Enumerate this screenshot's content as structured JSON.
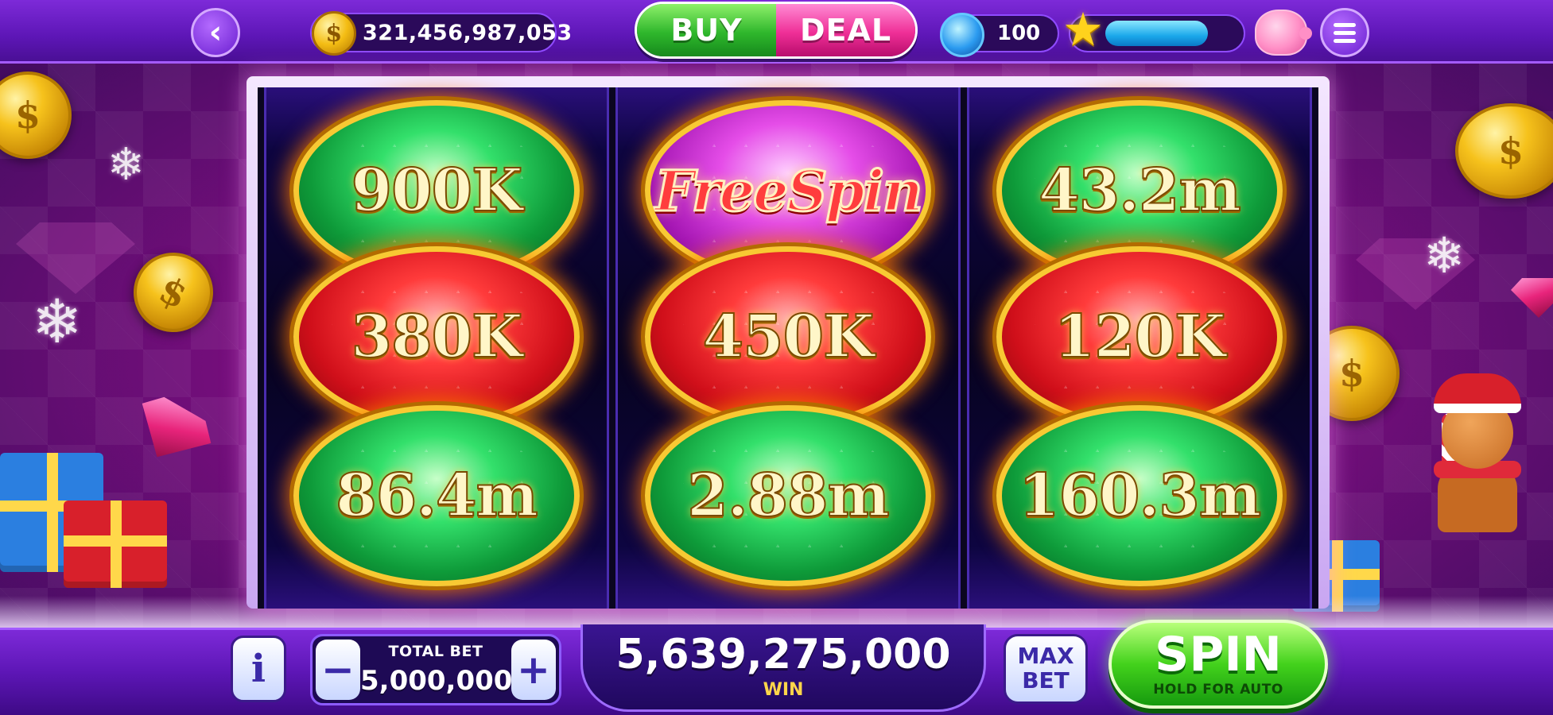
{
  "top_bar": {
    "balance": "321,456,987,053",
    "coin_symbol": "$",
    "buy_label": "BUY",
    "deal_label": "DEAL",
    "gems": "100",
    "xp_progress": 0.78
  },
  "reels": [
    [
      {
        "type": "green",
        "label": "900K"
      },
      {
        "type": "red",
        "label": "380K"
      },
      {
        "type": "green",
        "label": "86.4m"
      }
    ],
    [
      {
        "type": "purple",
        "label": "FreeSpin"
      },
      {
        "type": "red",
        "label": "450K"
      },
      {
        "type": "green",
        "label": "2.88m"
      }
    ],
    [
      {
        "type": "green",
        "label": "43.2m"
      },
      {
        "type": "red",
        "label": "120K"
      },
      {
        "type": "green",
        "label": "160.3m"
      }
    ]
  ],
  "bottom_bar": {
    "info_label": "i",
    "minus_label": "−",
    "plus_label": "+",
    "total_bet_label": "TOTAL BET",
    "total_bet_value": "5,000,000",
    "win_amount": "5,639,275,000",
    "win_label": "WIN",
    "max_bet_line1": "MAX",
    "max_bet_line2": "BET",
    "spin_label": "SPIN",
    "spin_sub": "HOLD FOR AUTO"
  },
  "icons": {
    "back": "chevron-left-icon",
    "coin": "coin-icon",
    "gem": "blue-gem-icon",
    "star": "star-icon",
    "piggy": "piggy-bank-icon",
    "menu": "hamburger-menu-icon"
  },
  "colors": {
    "accent_purple": "#6a1ed0",
    "buy_green": "#2fb72c",
    "deal_pink": "#ef2f97",
    "spin_green": "#43d21c",
    "win_gold": "#ffd54a"
  }
}
